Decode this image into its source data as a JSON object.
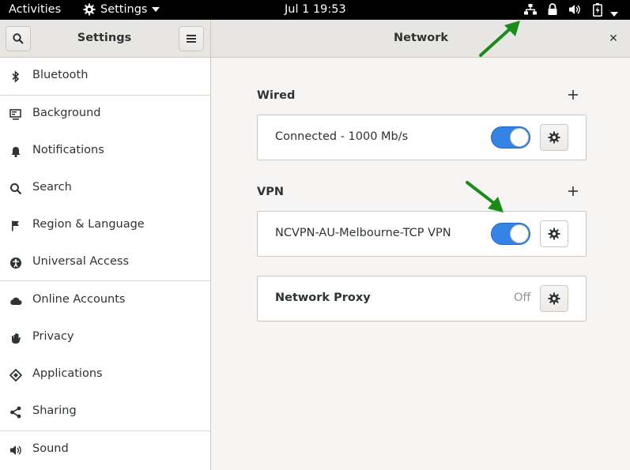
{
  "topbar": {
    "activities": "Activities",
    "app_menu": "Settings",
    "clock": "Jul 1  19:53"
  },
  "header": {
    "left_title": "Settings",
    "title": "Network",
    "close_glyph": "✕"
  },
  "sidebar": {
    "items": [
      {
        "label": "Bluetooth",
        "icon": "bluetooth-icon"
      },
      {
        "label": "Background",
        "icon": "background-icon"
      },
      {
        "label": "Notifications",
        "icon": "bell-icon"
      },
      {
        "label": "Search",
        "icon": "search-icon"
      },
      {
        "label": "Region & Language",
        "icon": "flag-icon"
      },
      {
        "label": "Universal Access",
        "icon": "accessibility-icon"
      },
      {
        "label": "Online Accounts",
        "icon": "cloud-icon"
      },
      {
        "label": "Privacy",
        "icon": "hand-icon"
      },
      {
        "label": "Applications",
        "icon": "applications-icon"
      },
      {
        "label": "Sharing",
        "icon": "share-icon"
      },
      {
        "label": "Sound",
        "icon": "speaker-icon"
      }
    ]
  },
  "network": {
    "wired": {
      "title": "Wired",
      "status": "Connected - 1000 Mb/s",
      "enabled": true
    },
    "vpn": {
      "title": "VPN",
      "connection": "NCVPN-AU-Melbourne-TCP VPN",
      "enabled": true
    },
    "proxy": {
      "label": "Network Proxy",
      "status": "Off"
    }
  },
  "colors": {
    "accent": "#3584e4",
    "annotation_arrow": "#1a8a1a"
  }
}
